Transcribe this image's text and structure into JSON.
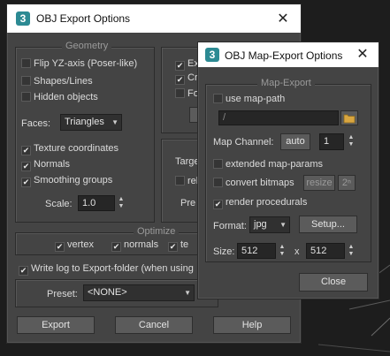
{
  "obj_export": {
    "title": "OBJ Export Options",
    "geometry": {
      "title": "Geometry",
      "flip_yz": "Flip YZ-axis (Poser-like)",
      "shapes_lines": "Shapes/Lines",
      "hidden_objects": "Hidden objects",
      "faces_label": "Faces:",
      "faces_value": "Triangles",
      "texture_coords": "Texture coordinates",
      "normals": "Normals",
      "smoothing_groups": "Smoothing groups",
      "scale_label": "Scale:",
      "scale_value": "1.0"
    },
    "right_partial": {
      "ex": "Ex",
      "cr": "Cr",
      "fo": "Fo",
      "targ": "Targe",
      "rel": "rel",
      "pre": "Pre"
    },
    "optimize": {
      "title": "Optimize",
      "vertex": "vertex",
      "normals": "normals",
      "te": "te"
    },
    "write_log": "Write log to Export-folder (when using",
    "preset_label": "Preset:",
    "preset_value": "<NONE>",
    "export_button": "Export",
    "cancel_button": "Cancel",
    "help_button": "Help"
  },
  "map_export": {
    "title": "OBJ Map-Export Options",
    "group_title": "Map-Export",
    "use_map_path": "use map-path",
    "path_value": "/",
    "map_channel_label": "Map Channel:",
    "auto_button": "auto",
    "channel_value": "1",
    "extended_map_params": "extended map-params",
    "convert_bitmaps": "convert bitmaps",
    "resize_button": "resize",
    "pow2_button": "2ⁿ",
    "render_procedurals": "render procedurals",
    "format_label": "Format:",
    "format_value": "jpg",
    "setup_button": "Setup...",
    "size_label": "Size:",
    "width_value": "512",
    "x_label": "x",
    "height_value": "512",
    "close_button": "Close"
  },
  "check_mark": "✔"
}
